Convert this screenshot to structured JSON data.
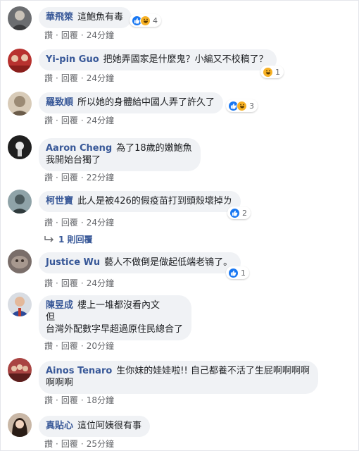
{
  "labels": {
    "like": "讚",
    "reply": "回覆"
  },
  "colors": {
    "name": "#385898",
    "bubble": "#f0f2f5",
    "like": "#1877f2",
    "haha": "#f7b125"
  },
  "comments": [
    {
      "name": "華飛箂",
      "lines": [
        "這鮑魚有毒"
      ],
      "reactions": [
        "like-icon",
        "haha-icon"
      ],
      "count": "4",
      "time": "24分鐘"
    },
    {
      "name": "Yi-pin Guo",
      "lines": [
        "把她弄國家是什麼鬼？小編又不校稿了？"
      ],
      "reactions": [
        "haha-icon"
      ],
      "count": "1",
      "time": "24分鐘"
    },
    {
      "name": "羅致順",
      "lines": [
        "所以她的身體給中國人弄了許久了"
      ],
      "reactions": [
        "like-icon",
        "haha-icon"
      ],
      "count": "3",
      "time": "24分鐘"
    },
    {
      "name": "Aaron Cheng",
      "lines": [
        "為了18歲的嫩鮑魚",
        "我開始台獨了"
      ],
      "reactions": [],
      "count": "",
      "time": "22分鐘"
    },
    {
      "name": "柯世寶",
      "lines": [
        "此人是被426的假疫苗打到頭殼壞掉ㄌ"
      ],
      "reactions": [
        "like-icon"
      ],
      "count": "2",
      "time": "24分鐘",
      "replies": "1 則回覆"
    },
    {
      "name": "Justice Wu",
      "lines": [
        "藝人不做倒是做起低端老鴇了。"
      ],
      "reactions": [
        "like-icon"
      ],
      "count": "1",
      "time": "24分鐘"
    },
    {
      "name": "陳昱成",
      "lines": [
        "樓上一堆都沒看內文",
        "但",
        "台灣外配數字早超過原住民總合了"
      ],
      "reactions": [],
      "count": "",
      "time": "20分鐘"
    },
    {
      "name": "Ainos Tenaro",
      "lines": [
        "生你妹的娃娃啦!! 自己都養不活了生屁啊啊啊啊",
        "啊啊啊"
      ],
      "reactions": [],
      "count": "",
      "time": "18分鐘"
    },
    {
      "name": "真貼心",
      "lines": [
        "這位阿姨很有事"
      ],
      "reactions": [],
      "count": "",
      "time": "25分鐘"
    }
  ]
}
